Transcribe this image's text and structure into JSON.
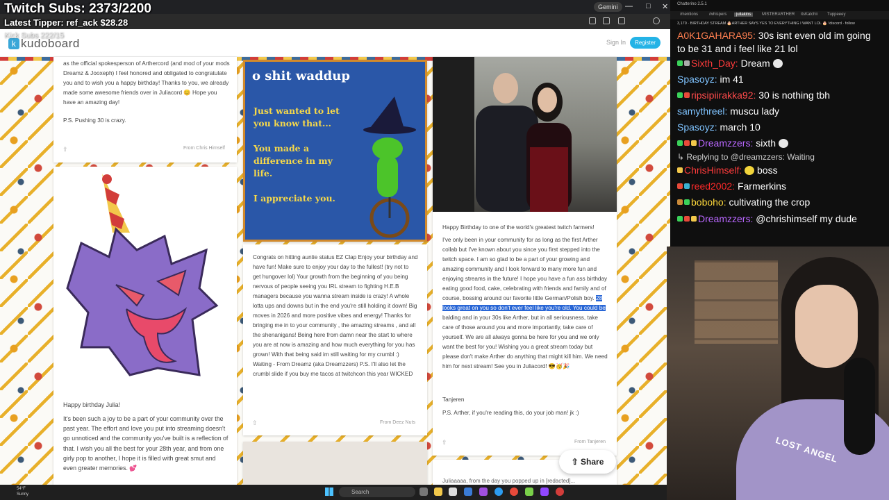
{
  "overlay": {
    "subs": "Twitch Subs: 2373/2200",
    "tipper": "Latest Tipper: ref_ack  $28.28",
    "kick": "Kick Subs 222/15"
  },
  "browser": {
    "gemini_label": "Gemini",
    "logo_text": "kudoboard",
    "sign_in": "Sign In",
    "register": "Register",
    "share": "Share",
    "share_icon": "share-icon"
  },
  "cards": {
    "card1": {
      "text": "as the official spokesperson of Arthercord (and mod of your mods Dreamz & Jooxeph) I feel honored and obligated to congratulate you and to wish you a happy birthday! Thanks to you, we already made some awesome friends over in Juliacord 😊 Hope you have an amazing day!",
      "ps": "P.S. Pushing 30 is crazy.",
      "from": "From Chris Himself"
    },
    "card2": {
      "title": "o shit waddup",
      "lines": [
        "Just wanted to let you know that...",
        "You made a difference in my life.",
        "I appreciate you."
      ]
    },
    "card3": {
      "text": "Congrats on hitting auntie status EZ Clap Enjoy your birthday and have fun! Make sure to enjoy your day to the fullest! (try not to get hungover lol) Your growth from the beginning of you being nervous of people seeing you IRL stream to fighting H.E.B managers because you wanna stream inside is crazy! A whole lotta ups and downs but in the end you're still holding it down! Big moves in 2026 and more positive vibes and energy! Thanks for bringing me in to your community , the amazing streams , and all the shenanigans! Being here from damn near the start to where you are at now is amazing and how much everything for you has grown! With that being said im still waiting for my crumbl :) Waiting - From Dreamz (aka Dreamzzers) P.S. I'll also let the crumbl slide if you buy me tacos at twitchcon this year WICKED",
      "from": "From Deez Nuts"
    },
    "card4": {
      "greeting": "Happy Birthday to one of the world's greatest twitch farmers!",
      "text_before": "I've only been in your community for as long as the first Arther collab but I've known about you since you first stepped into the twitch space. I am so glad to be a part of your growing and amazing community and I look forward to many more fun and enjoying streams in the future! I hope you have a fun ass birthday eating good food, cake, celebrating with friends and family and of course, bossing around our favorite little German/Polish boy.",
      "text_highlight": "28 looks great on you so don't ever feel like you're old. You could be",
      "text_after": "balding and in your 30s like Arther, but in all seriousness, take care of those around you and more importantly, take care of yourself. We are all always gonna be here for you and we only want the best for you! Wishing you a great stream today but please don't make Arther do anything that might kill him. We need him for next stream! See you in Juliacord! 😎🥳🎉",
      "signature": "Tanjeren",
      "ps": "P.S. Arther, if you're reading this, do your job man! jk :)",
      "from": "From Tanjeren",
      "next_preview": "Juliaaaaa, from the day you popped up in [redacted]..."
    },
    "card5": {
      "title": "Happy birthday Julia!",
      "text": "It's been such a joy to be a part of your community over the past year. The effort and love you put into streaming doesn't go unnoticed and the community you've built is a reflection of that. I wish you all the best for your 28th year, and from one girly pop to another, I hope it is filled with great smut and even greater memories. 💕"
    }
  },
  "taskbar": {
    "weather_temp": "54°F",
    "weather_desc": "Sunny",
    "search": "Search"
  },
  "chat": {
    "title": "Chatterino 2.5.1",
    "tabs": [
      "/mentions",
      "/whispers",
      "juliakins",
      "MISTERARTHER",
      "itsKatchii",
      "Tuppeeey"
    ],
    "active_tab": "juliakins",
    "banner": "3,170 · BIRTHDAY STREAM 🎂ARTHER SAYS YES TO EVERYTHING I WANT LOL 🎂 !discord · follow",
    "messages": [
      {
        "user": "A0K1GAHARA95:",
        "color": "#ff7f50",
        "text": "30s isnt even old im going to be 31 and i feel like 21 lol"
      },
      {
        "user": "Sixth_Day:",
        "color": "#ff3b3b",
        "text": "Dream"
      },
      {
        "user": "Spasoyz:",
        "color": "#7fc3ff",
        "text": "im 41"
      },
      {
        "user": "ripsipiirakka92:",
        "color": "#ff4b4b",
        "text": "30 is nothing tbh"
      },
      {
        "user": "samythreel:",
        "color": "#7fc3ff",
        "text": "muscu lady"
      },
      {
        "user": "Spasoyz:",
        "color": "#7fc3ff",
        "text": "march 10"
      },
      {
        "user": "Dreamzzers:",
        "color": "#b967ff",
        "text": "sixth"
      },
      {
        "reply": "Replying to @dreamzzers: Waiting"
      },
      {
        "user": "ChrisHimself:",
        "color": "#ff3b3b",
        "text": "boss"
      },
      {
        "user": "reed2002:",
        "color": "#ff2a2a",
        "text": "Farmerkins"
      },
      {
        "user": "boboho:",
        "color": "#ffd93b",
        "text": "cultivating the crop"
      },
      {
        "user": "Dreamzzers:",
        "color": "#b967ff",
        "text": "@chrishimself my dude"
      }
    ]
  },
  "webcam": {
    "hoodie_text": "LOST ANGEL"
  }
}
